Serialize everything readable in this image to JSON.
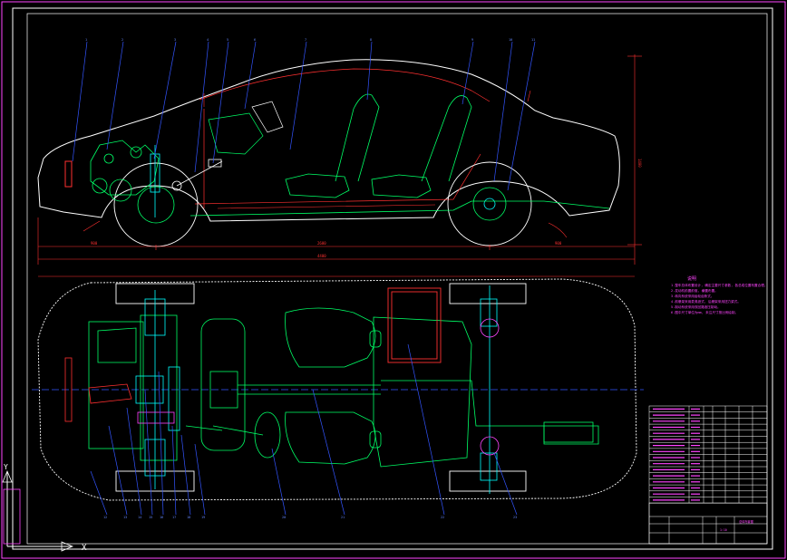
{
  "drawing": {
    "notes_title": "说明",
    "notes_lines": [
      "1.整车总体布置设计, 确定主要尺寸参数, 各总成位置布置合理。",
      "2.发动机前置前驱, 横置布置。",
      "3.转向系统采用齿轮齿条式。",
      "4.前悬架采用麦弗逊式, 后悬架采用扭力梁式。",
      "5.制动系统采用双回路液压制动。",
      "6.图中尺寸单位为mm, 未注尺寸按比例绘制。"
    ],
    "dimensions": {
      "front_overhang": "900",
      "wheelbase": "2600",
      "rear_overhang": "900",
      "overall_length": "4400",
      "overall_height": "1400"
    },
    "title_block": {
      "drawing_name": "总体布置图",
      "scale": "1:10"
    },
    "colors": {
      "background": "#000000",
      "frame": "#ffffff",
      "outline": "#ff44ff",
      "body": "#ffffff",
      "chassis": "#00ff66",
      "dimension": "#ff3030",
      "leader": "#3355ff",
      "cyan": "#00ffff",
      "yellow": "#ffff00"
    },
    "ucs_icon": "ucs-axis-icon"
  }
}
